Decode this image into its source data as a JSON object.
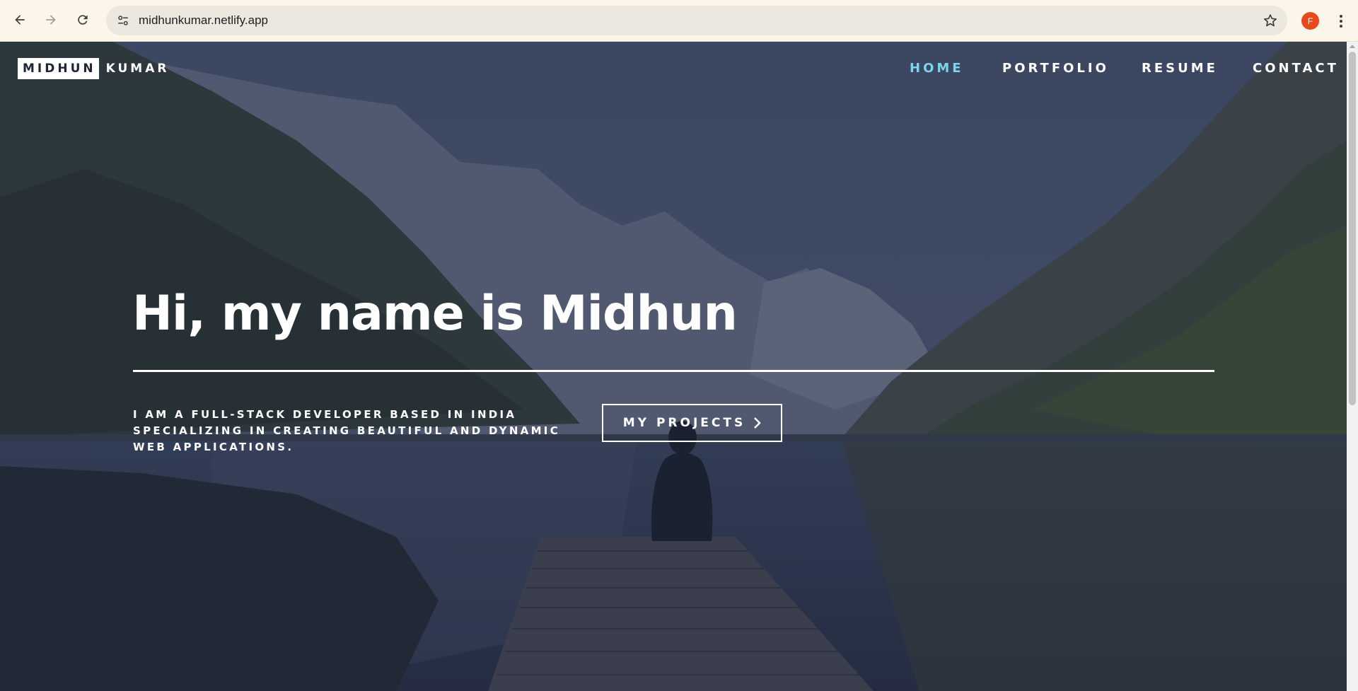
{
  "browser": {
    "url": "midhunkumar.netlify.app",
    "profile_initial": "F"
  },
  "site": {
    "logo_box": "MIDHUN",
    "logo_text": "KUMAR",
    "nav": [
      {
        "label": "HOME",
        "active": true
      },
      {
        "label": "PORTFOLIO",
        "active": false
      },
      {
        "label": "RESUME",
        "active": false
      },
      {
        "label": "CONTACT",
        "active": false
      }
    ],
    "colors": {
      "overlay": "#1e2538",
      "active_nav": "#7fd4ec",
      "text": "#ffffff"
    }
  },
  "hero": {
    "headline": "Hi, my name is Midhun",
    "tagline": "I AM A FULL-STACK DEVELOPER BASED IN INDIA SPECIALIZING IN CREATING BEAUTIFUL AND DYNAMIC WEB APPLICATIONS.",
    "cta_label": "MY PROJECTS",
    "cta_icon": "chevron-right-icon"
  }
}
